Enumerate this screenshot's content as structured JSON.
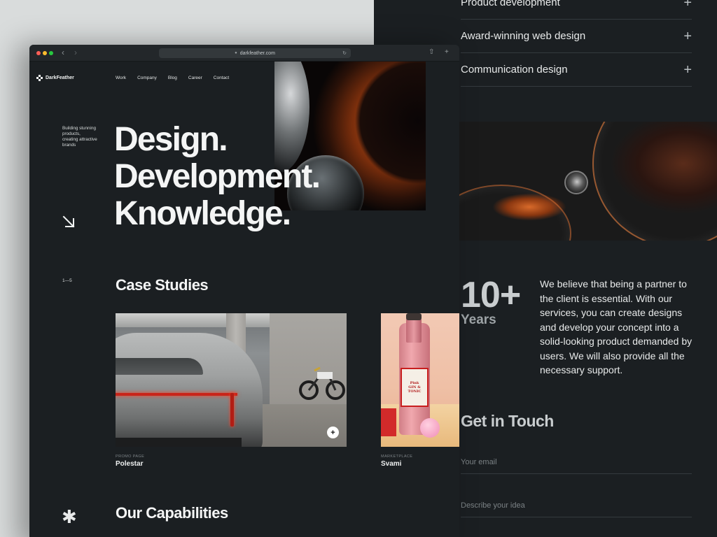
{
  "browser": {
    "url": "darkfeather.com"
  },
  "brand": {
    "name": "DarkFeather"
  },
  "nav": {
    "items": [
      "Work",
      "Company",
      "Blog",
      "Career",
      "Contact"
    ]
  },
  "hero": {
    "tagline": "Building stunning products, creating attractive brands",
    "lines": [
      "Design.",
      "Development.",
      "Knowledge."
    ]
  },
  "case_studies": {
    "counter": "1—5",
    "title": "Case Studies",
    "cards": [
      {
        "category": "PROMO PAGE",
        "title": "Polestar"
      },
      {
        "category": "MARKETPLACE",
        "title": "Svami"
      }
    ],
    "bottle_label": [
      "Pink",
      "GIN &",
      "TONIC"
    ]
  },
  "capabilities": {
    "title": "Our Capabilities"
  },
  "services": {
    "items": [
      "Product development",
      "Award-winning web design",
      "Communication design"
    ]
  },
  "stats": {
    "number": "10+",
    "label": "Years",
    "description": "We believe that being a partner to the client is essential. With our services, you can create designs and develop your concept into a solid-looking product demanded by users. We will also provide all the necessary support."
  },
  "contact": {
    "title": "Get in Touch",
    "email_placeholder": "Your email",
    "idea_placeholder": "Describe your idea"
  },
  "colors": {
    "background": "#1b1f22",
    "accent_orange": "#d06226",
    "close_dot": "#ff5f57",
    "minimize_dot": "#febc2e",
    "zoom_dot": "#28c840"
  }
}
